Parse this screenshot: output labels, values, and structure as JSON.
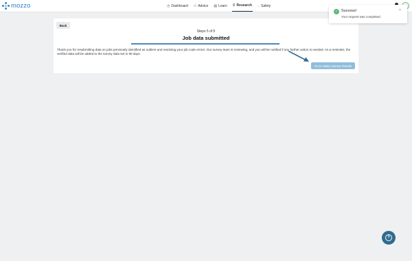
{
  "app": {
    "logo_text": "mozzo",
    "brand_color": "#2f7cc1"
  },
  "nav": {
    "items": [
      {
        "label": "Dashboard",
        "icon": "dashboard-icon",
        "glyph": "◷"
      },
      {
        "label": "Advice",
        "icon": "advice-icon",
        "glyph": "⚇"
      },
      {
        "label": "Learn",
        "icon": "book-icon",
        "glyph": "▤"
      },
      {
        "label": "Research",
        "icon": "research-icon",
        "glyph": "⚲",
        "active": true
      },
      {
        "label": "Safety",
        "icon": "shield-icon",
        "glyph": "◌"
      }
    ]
  },
  "card": {
    "back_label": "Back",
    "step_text": "Steps 5 of 5",
    "title": "Job data submitted",
    "progress": 1.0,
    "message": "Thank you for resubmitting data on jobs previously identified as outliers and resolving your job code errors. Our survey team is reviewing, and you will be notified if any further action is needed. As a reminder, the verified data will be added to the survey data set in 90 days.",
    "cta_label": "Go to Salary Survey Results"
  },
  "toast": {
    "title": "Success!",
    "message": "Your request was completed.",
    "close_glyph": "×",
    "status_color": "#5bb77a"
  },
  "help": {
    "glyph": "?"
  }
}
